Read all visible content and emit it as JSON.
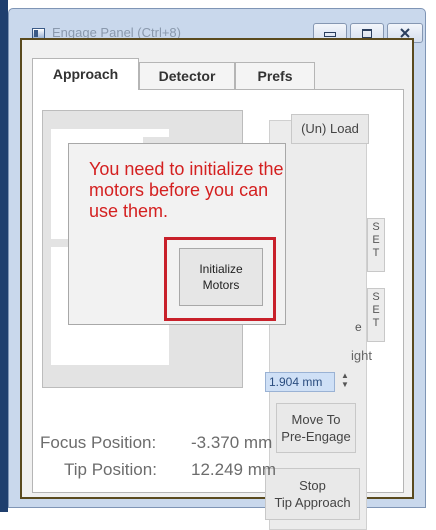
{
  "window": {
    "title": "Engage Panel (Ctrl+8)"
  },
  "tabs": [
    {
      "label": "Approach",
      "active": true
    },
    {
      "label": "Detector",
      "active": false
    },
    {
      "label": "Prefs",
      "active": false
    }
  ],
  "approach": {
    "load_button": "(Un) Load",
    "set_button_1": "S\nE\nT",
    "set_button_2": "S\nE\nT",
    "partial_label_e": "e",
    "height_label_partial": "ight",
    "pre_engage_value": "1.904 mm",
    "move_button": "Move To\nPre-Engage",
    "stop_button": "Stop\nTip Approach",
    "focus_position_label": "Focus Position:",
    "focus_position_value": "-3.370 mm",
    "tip_position_label": "Tip Position:",
    "tip_position_value": "12.249 mm"
  },
  "popup": {
    "message": "You need to initialize the motors before you can use them.",
    "button_label": "Initialize\nMotors"
  },
  "colors": {
    "accent_red": "#d42020",
    "highlight_border": "#c8202a",
    "window_frame": "#1f3f6e",
    "client_border": "#5a4a1e"
  }
}
